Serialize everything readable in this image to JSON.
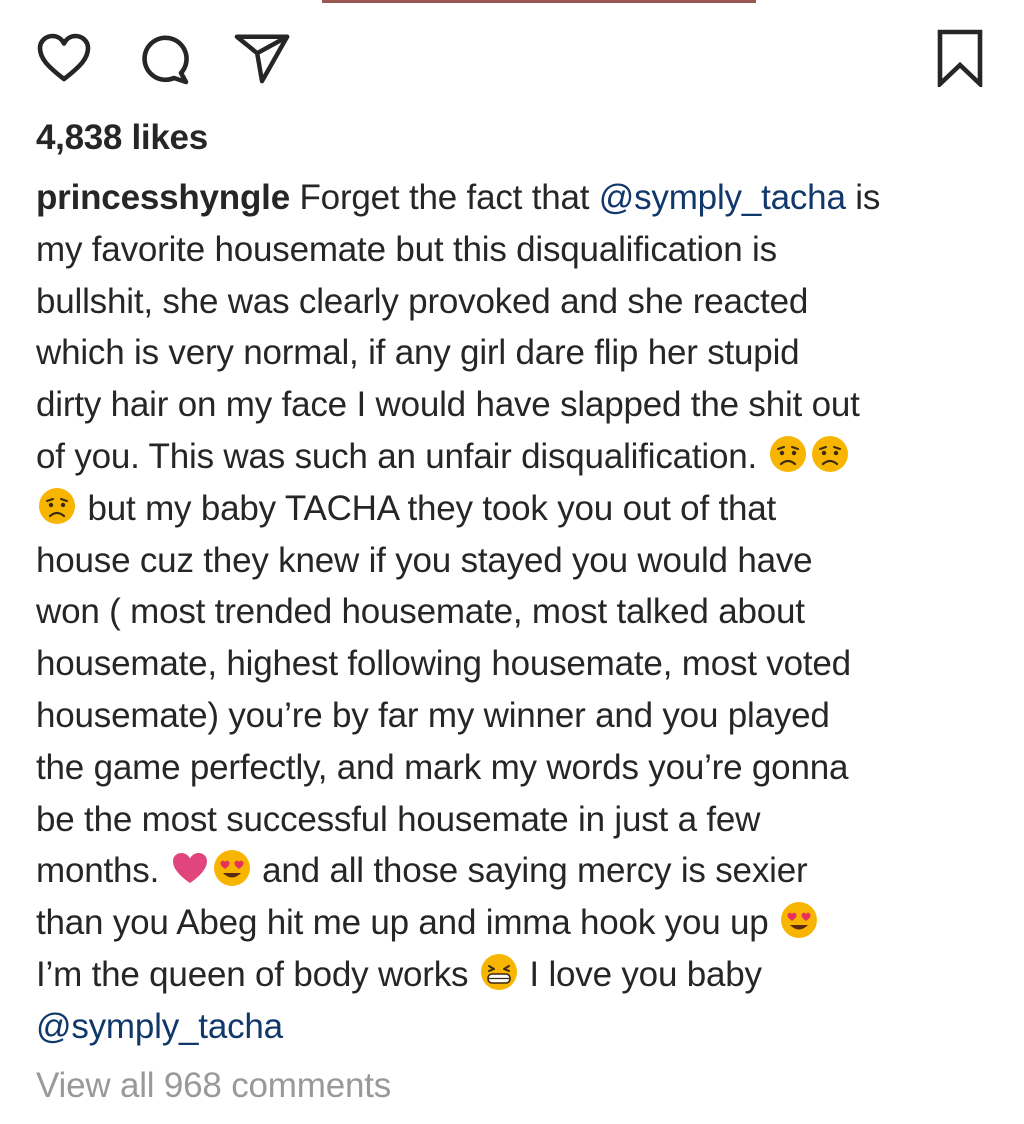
{
  "post": {
    "likes_text": "4,838 likes",
    "username": "princesshyngle",
    "caption_lines": [
      [
        {
          "type": "user",
          "text": "princesshyngle"
        },
        {
          "type": "text",
          "text": " Forget the fact that "
        },
        {
          "type": "mention",
          "text": "@symply_tacha"
        },
        {
          "type": "text",
          "text": " is"
        }
      ],
      [
        {
          "type": "text",
          "text": "my favorite housemate but this disqualification is"
        }
      ],
      [
        {
          "type": "text",
          "text": "bullshit, she was clearly provoked and she reacted"
        }
      ],
      [
        {
          "type": "text",
          "text": "which is very normal, if any girl dare flip her stupid"
        }
      ],
      [
        {
          "type": "text",
          "text": "dirty hair on my face I would have slapped the shit out"
        }
      ],
      [
        {
          "type": "text",
          "text": "of you. This was such an unfair disqualification. "
        },
        {
          "type": "emoji",
          "name": "frowning-face-emoji"
        },
        {
          "type": "emoji",
          "name": "frowning-face-emoji"
        }
      ],
      [
        {
          "type": "emoji",
          "name": "frowning-face-emoji"
        },
        {
          "type": "text",
          "text": " but my baby TACHA they took you out of that"
        }
      ],
      [
        {
          "type": "text",
          "text": "house cuz they knew if you stayed you would have"
        }
      ],
      [
        {
          "type": "text",
          "text": "won ( most trended housemate, most talked about"
        }
      ],
      [
        {
          "type": "text",
          "text": "housemate, highest following housemate, most voted"
        }
      ],
      [
        {
          "type": "text",
          "text": "housemate) you’re by far my winner and you played"
        }
      ],
      [
        {
          "type": "text",
          "text": "the game perfectly, and mark my words you’re gonna"
        }
      ],
      [
        {
          "type": "text",
          "text": "be the most successful housemate in just a few"
        }
      ],
      [
        {
          "type": "text",
          "text": "months. "
        },
        {
          "type": "emoji",
          "name": "pink-heart-emoji"
        },
        {
          "type": "emoji",
          "name": "heart-eyes-emoji"
        },
        {
          "type": "text",
          "text": " and all those saying mercy is sexier"
        }
      ],
      [
        {
          "type": "text",
          "text": "than you Abeg hit me up and imma hook you up "
        },
        {
          "type": "emoji",
          "name": "heart-eyes-emoji"
        }
      ],
      [
        {
          "type": "text",
          "text": "I’m the queen of body works "
        },
        {
          "type": "emoji",
          "name": "grinning-squint-emoji"
        },
        {
          "type": "text",
          "text": " I love you baby"
        }
      ],
      [
        {
          "type": "mention",
          "text": "@symply_tacha"
        }
      ]
    ],
    "view_comments_text": "View all 968 comments"
  },
  "actions": {
    "like_icon": "heart-outline-icon",
    "comment_icon": "comment-bubble-icon",
    "share_icon": "paper-plane-icon",
    "save_icon": "bookmark-outline-icon"
  },
  "colors": {
    "text": "#262626",
    "mention": "#10386b",
    "muted": "#999999",
    "emoji_face": "#f7b500"
  }
}
